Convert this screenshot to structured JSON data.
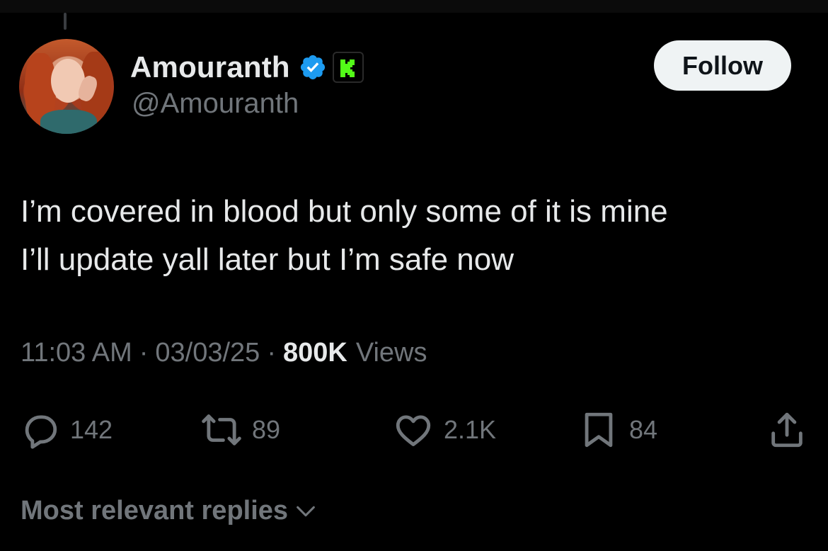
{
  "author": {
    "display_name": "Amouranth",
    "handle": "@Amouranth"
  },
  "follow_label": "Follow",
  "tweet": {
    "line1": "I’m covered in blood but only some of it is mine",
    "line2": "I’ll update yall later but I’m safe now"
  },
  "meta": {
    "time": "11:03 AM",
    "separator": "·",
    "date": "03/03/25",
    "views_count": "800K",
    "views_label": "Views"
  },
  "actions": {
    "replies": "142",
    "reposts": "89",
    "likes": "2.1K",
    "bookmarks": "84"
  },
  "replies_sort_label": "Most relevant replies",
  "icons": {
    "reply": "reply-icon",
    "repost": "repost-icon",
    "like": "heart-icon",
    "bookmark": "bookmark-icon",
    "share": "share-icon",
    "verified": "verified-badge-icon",
    "kick": "kick-badge-icon"
  },
  "colors": {
    "background": "#000000",
    "text_primary": "#e7e9ea",
    "text_secondary": "#71767b",
    "verified_blue": "#1d9bf0",
    "kick_green": "#53fc18",
    "follow_bg": "#eff3f4"
  }
}
